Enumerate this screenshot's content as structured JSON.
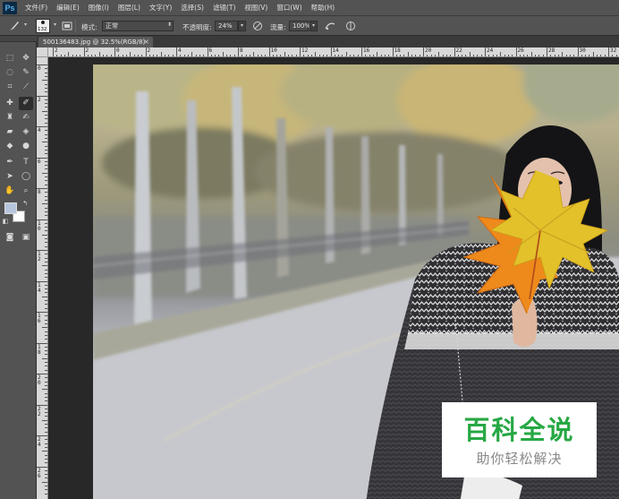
{
  "app": {
    "logo": "Ps"
  },
  "menu": [
    "文件(F)",
    "编辑(E)",
    "图像(I)",
    "图层(L)",
    "文字(Y)",
    "选择(S)",
    "滤镜(T)",
    "视图(V)",
    "窗口(W)",
    "帮助(H)"
  ],
  "options": {
    "brush_size": "132",
    "mode_label": "模式:",
    "mode_value": "正常",
    "opacity_label": "不透明度:",
    "opacity_value": "24%",
    "flow_label": "流量:",
    "flow_value": "100%"
  },
  "document": {
    "tab_title": "500136483.jpg @ 32.5%(RGB/8)",
    "close_glyph": "×"
  },
  "ruler": {
    "top_labels": [
      "2",
      "2",
      "0",
      "2",
      "4",
      "6",
      "8",
      "10",
      "12",
      "14",
      "16",
      "18",
      "20",
      "22",
      "24",
      "26",
      "28",
      "30",
      "32",
      "34",
      "36"
    ],
    "left_labels": [
      "0",
      "2",
      "4",
      "6",
      "8",
      "1 0",
      "1 2",
      "1 4",
      "1 6",
      "1 8",
      "2 0",
      "2 2",
      "2 4",
      "2 6"
    ]
  },
  "watermark": {
    "title": "百科全说",
    "subtitle": "助你轻松解决"
  },
  "colors": {
    "chrome": "#535353",
    "dark_chrome": "#3a3a3a",
    "watermark_green": "#27a844",
    "leaf_orange": "#ee8a1c",
    "leaf_yellow": "#e2c12a"
  },
  "icons": [
    "brush-icon",
    "brush-panel-icon",
    "airbrush-icon",
    "pressure-opacity-icon",
    "pressure-size-icon",
    "marquee-icon",
    "move-icon",
    "lasso-icon",
    "quick-select-icon",
    "crop-icon",
    "eyedropper-icon",
    "healing-icon",
    "brush-tool-icon",
    "stamp-icon",
    "history-brush-icon",
    "eraser-icon",
    "bucket-icon",
    "blur-icon",
    "dodge-icon",
    "pen-icon",
    "type-icon",
    "path-select-icon",
    "shape-icon",
    "hand-icon",
    "zoom-icon",
    "color-swatch-icon",
    "quick-mask-icon",
    "screen-mode-icon"
  ]
}
